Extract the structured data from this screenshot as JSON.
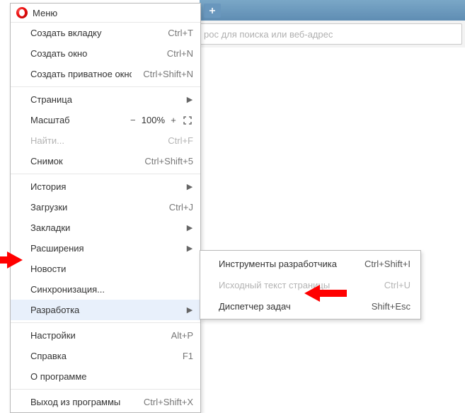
{
  "browser": {
    "address_placeholder": "рос для поиска или веб-адрес"
  },
  "menu": {
    "title": "Меню",
    "items_a": [
      {
        "label": "Создать вкладку",
        "shortcut": "Ctrl+T"
      },
      {
        "label": "Создать окно",
        "shortcut": "Ctrl+N"
      },
      {
        "label": "Создать приватное окно",
        "shortcut": "Ctrl+Shift+N"
      }
    ],
    "page": {
      "label": "Страница"
    },
    "zoom": {
      "label": "Масштаб",
      "value": "100%"
    },
    "find": {
      "label": "Найти...",
      "shortcut": "Ctrl+F"
    },
    "snap": {
      "label": "Снимок",
      "shortcut": "Ctrl+Shift+5"
    },
    "items_c": [
      {
        "label": "История"
      },
      {
        "label": "Загрузки",
        "shortcut": "Ctrl+J"
      },
      {
        "label": "Закладки"
      },
      {
        "label": "Расширения"
      },
      {
        "label": "Новости"
      },
      {
        "label": "Синхронизация..."
      },
      {
        "label": "Разработка"
      }
    ],
    "items_d": [
      {
        "label": "Настройки",
        "shortcut": "Alt+P"
      },
      {
        "label": "Справка",
        "shortcut": "F1"
      },
      {
        "label": "О программе"
      }
    ],
    "exit": {
      "label": "Выход из программы",
      "shortcut": "Ctrl+Shift+X"
    }
  },
  "submenu": {
    "items": [
      {
        "label": "Инструменты разработчика",
        "shortcut": "Ctrl+Shift+I"
      },
      {
        "label": "Исходный текст страницы",
        "shortcut": "Ctrl+U",
        "disabled": true
      },
      {
        "label": "Диспетчер задач",
        "shortcut": "Shift+Esc"
      }
    ]
  }
}
